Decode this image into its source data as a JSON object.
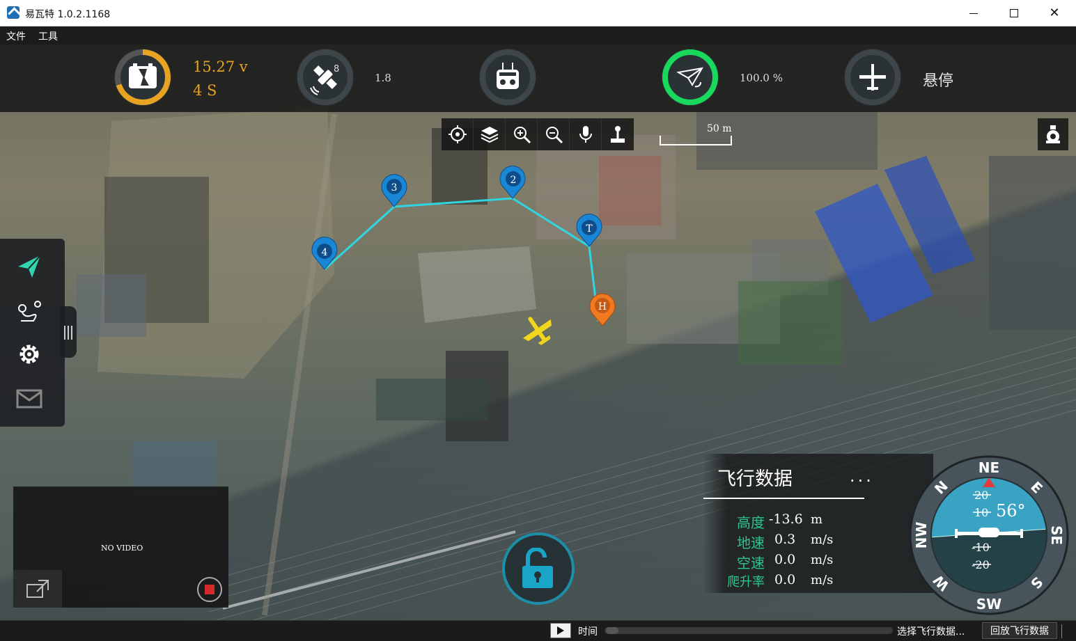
{
  "window": {
    "title": "易瓦特 1.0.2.1168"
  },
  "menu": {
    "file": "文件",
    "tools": "工具"
  },
  "status": {
    "battery_voltage": "15.27 v",
    "battery_cells": "4 S",
    "battery_level_fraction": 0.7,
    "gps_satellites": "8",
    "gps_hdop": "1.8",
    "signal_percent": "100.0 %",
    "signal_level_fraction": 1.0,
    "flight_mode": "悬停",
    "colors": {
      "battery": "#e8a321",
      "signal": "#19d95c"
    },
    "icons": [
      "battery-icon",
      "satellite-icon",
      "remote-controller-icon",
      "paper-plane-signal-icon",
      "airplane-icon"
    ]
  },
  "map_toolbar": {
    "icons": [
      "locate-icon",
      "layers-icon",
      "zoom-in-icon",
      "zoom-out-icon",
      "microphone-icon",
      "joystick-icon"
    ]
  },
  "scale": {
    "label": "50 m"
  },
  "waypoints": {
    "labels": [
      "3",
      "2",
      "T",
      "4",
      "H"
    ],
    "route_color": "#2fd6e0",
    "waypoint_color": "#1a86d6",
    "home_color": "#f07a22",
    "aircraft_color": "#f2d61c"
  },
  "sidebar": {
    "icons": [
      "send-icon",
      "route-planning-icon",
      "settings-gear-icon",
      "mail-icon"
    ]
  },
  "video": {
    "no_video": "NO VIDEO"
  },
  "flight_data": {
    "title": "飞行数据",
    "more": "...",
    "rows": [
      {
        "label": "高度",
        "value": "-13.6",
        "unit": "m"
      },
      {
        "label": "地速",
        "value": "0.3",
        "unit": "m/s"
      },
      {
        "label": "空速",
        "value": "0.0",
        "unit": "m/s"
      },
      {
        "label": "爬升率",
        "value": "0.0",
        "unit": "m/s"
      }
    ]
  },
  "compass": {
    "heading": "56°",
    "labels": [
      "NE",
      "E",
      "SE",
      "S",
      "SW",
      "W",
      "NW",
      "N"
    ],
    "pitch_ticks": [
      "20",
      "10",
      "-10",
      "-20"
    ]
  },
  "bottom": {
    "time_label": "时间",
    "select_data": "选择飞行数据...",
    "replay_button": "回放飞行数据"
  }
}
